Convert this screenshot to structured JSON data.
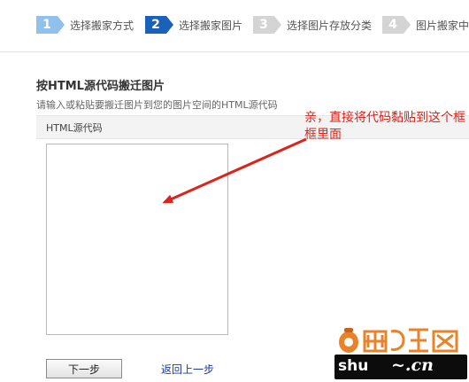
{
  "steps": [
    {
      "number": "1",
      "label": "选择搬家方式",
      "state": "done"
    },
    {
      "number": "2",
      "label": "选择搬家图片",
      "state": "active"
    },
    {
      "number": "3",
      "label": "选择图片存放分类",
      "state": "todo"
    },
    {
      "number": "4",
      "label": "图片搬家中",
      "state": "todo"
    }
  ],
  "section": {
    "title": "按HTML源代码搬迁图片",
    "hint": "请输入或粘贴要搬迁图片到您的图片空间的HTML源代码",
    "field_label": "HTML源代码",
    "textarea_value": ""
  },
  "actions": {
    "next_label": "下一步",
    "back_label": "返回上一步"
  },
  "annotation": {
    "text": "亲，直接将代码黏贴到这个框框里面",
    "color": "#d9261c"
  },
  "colors": {
    "step_done": "#8fc1ec",
    "step_active": "#1a62b9",
    "step_todo": "#d4d4d4",
    "link": "#1a3a9c"
  }
}
